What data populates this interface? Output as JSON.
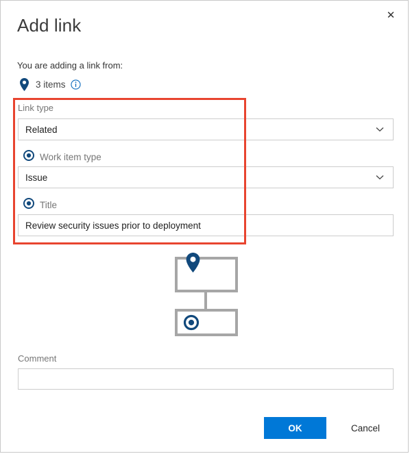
{
  "dialog": {
    "title": "Add link",
    "close_label": "✕"
  },
  "source": {
    "intro_text": "You are adding a link from:",
    "items_count_text": "3 items",
    "pin_icon": "location-pin-icon",
    "info_icon": "info-circle-icon"
  },
  "form": {
    "link_type": {
      "label": "Link type",
      "value": "Related",
      "chevron": "chevron-down-icon"
    },
    "work_item_type": {
      "label": "Work item type",
      "value": "Issue",
      "radio_state": "selected",
      "chevron": "chevron-down-icon"
    },
    "title_field": {
      "label": "Title",
      "value": "Review security issues prior to deployment",
      "radio_state": "selected",
      "placeholder": ""
    },
    "comment": {
      "label": "Comment",
      "value": "",
      "placeholder": ""
    }
  },
  "diagram": {
    "top_node_icon": "location-pin-icon",
    "bottom_node_icon": "target-radio-icon"
  },
  "footer": {
    "ok_label": "OK",
    "cancel_label": "Cancel"
  },
  "colors": {
    "accent_blue": "#0078d7",
    "deep_blue": "#11497c",
    "highlight_red": "#e8442f",
    "border_gray": "#cccccc",
    "label_gray": "#767676",
    "diagram_gray": "#a6a6a6"
  }
}
